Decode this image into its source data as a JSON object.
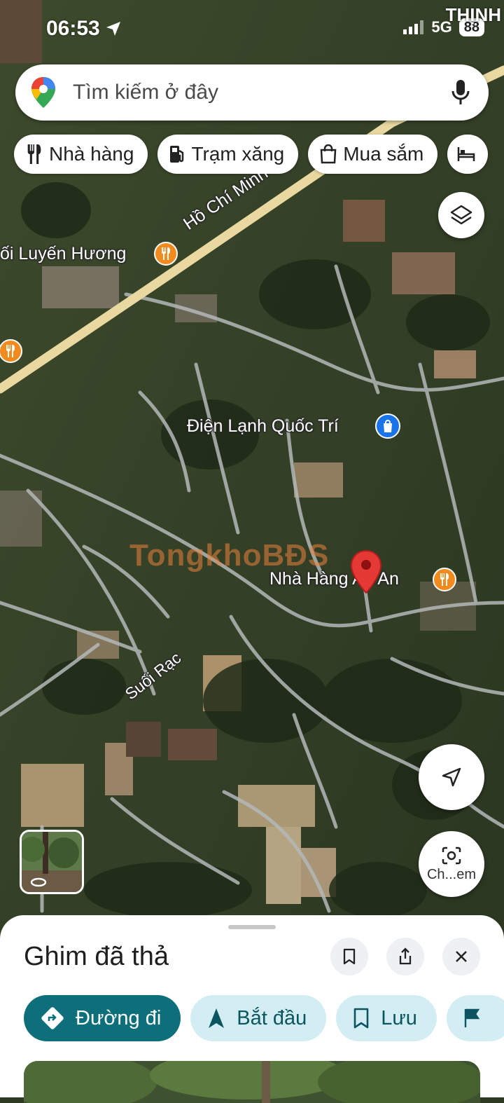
{
  "status_bar": {
    "time": "06:53",
    "network": "5G",
    "battery": "88",
    "corner_text": "THỊNH"
  },
  "search": {
    "placeholder": "Tìm kiếm ở đây",
    "left_icon": "google-maps-pin-icon",
    "right_icon": "mic-icon"
  },
  "chips": [
    {
      "label": "Nhà hàng",
      "icon": "restaurant-icon"
    },
    {
      "label": "Trạm xăng",
      "icon": "gas-station-icon"
    },
    {
      "label": "Mua sắm",
      "icon": "shopping-bag-icon"
    }
  ],
  "map": {
    "road_label": "Hồ Chí Minh",
    "labels": {
      "luyen_huong": "ối Luyến Hương",
      "dien_lanh": "Điện Lạnh Quốc Trí",
      "nha_hang": "Nhà Hàng An An",
      "suoi_rac": "Suối Rạc"
    },
    "watermark": "TongkhoBĐS",
    "colors": {
      "road": "#e9d9a0",
      "poi_food": "#f28a1e",
      "poi_shop": "#1a73e8",
      "pin": "#e53935"
    }
  },
  "fabs": {
    "camera_label": "Ch...em"
  },
  "sheet": {
    "title": "Ghim đã thả",
    "actions": [
      {
        "label": "Đường đi",
        "icon": "directions-icon"
      },
      {
        "label": "Bắt đầu",
        "icon": "navigation-arrow-icon"
      },
      {
        "label": "Lưu",
        "icon": "bookmark-icon"
      }
    ],
    "colors": {
      "primary": "#0d6f7a",
      "secondary": "#d3eef2"
    }
  }
}
